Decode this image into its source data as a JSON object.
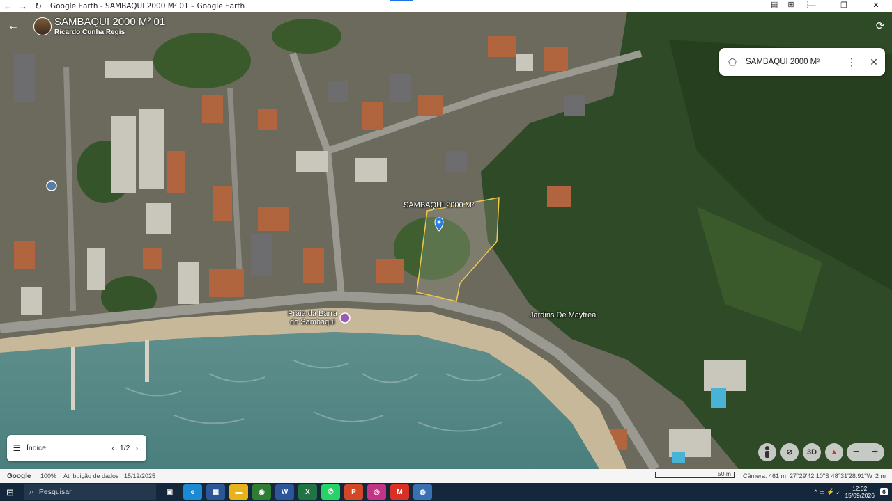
{
  "window": {
    "title": "Google Earth - SAMBAQUI 2000 M² 01 – Google Earth",
    "nav_back": "←",
    "nav_forward": "→",
    "nav_reload": "↻",
    "tool_icons": [
      "clipboard-icon",
      "translate-icon",
      "more-icon"
    ],
    "win_min": "—",
    "win_max": "❐",
    "win_close": "✕"
  },
  "header": {
    "title": "SAMBAQUI 2000 M² 01",
    "author": "Ricardo Cunha Regis",
    "back_icon": "←",
    "sync_icon": "⟳"
  },
  "info_card": {
    "name": "SAMBAQUI 2000 M²",
    "polygon_icon": "⬠",
    "more_icon": "⋮",
    "close_icon": "✕"
  },
  "map": {
    "polygon_label": "SAMBAQUI 2000 M²",
    "place_1_line1": "Praia da Barra",
    "place_1_line2": "do Sambaqui",
    "place_2": "Jardins De Maytrea",
    "polygon_color": "#f2c94c"
  },
  "index_card": {
    "list_icon": "☰",
    "label": "Índice",
    "prev": "‹",
    "page": "1/2",
    "next": "›"
  },
  "controls": {
    "pegman": "🚶",
    "tilt": "⊘",
    "three_d": "3D",
    "compass": "▲",
    "zoom_out": "−",
    "zoom_in": "+"
  },
  "status": {
    "google": "Google",
    "zoom": "100%",
    "attribution": "Atribuição de dados",
    "date": "15/12/2025",
    "scale": "50 m",
    "camera": "Câmera: 461 m",
    "coords": "27°29'42.10\"S 48°31'28.91\"W",
    "elevation": "2 m"
  },
  "taskbar": {
    "search": "Pesquisar",
    "apps": [
      {
        "name": "task-view",
        "glyph": "▣",
        "color": "#15273a"
      },
      {
        "name": "edge",
        "glyph": "e",
        "color": "#1b8ad3"
      },
      {
        "name": "store",
        "glyph": "▦",
        "color": "#2b5797"
      },
      {
        "name": "explorer",
        "glyph": "▬",
        "color": "#e8b21a"
      },
      {
        "name": "chrome",
        "glyph": "◉",
        "color": "#2e7d32"
      },
      {
        "name": "word",
        "glyph": "W",
        "color": "#2b579a"
      },
      {
        "name": "excel",
        "glyph": "X",
        "color": "#217346"
      },
      {
        "name": "whatsapp",
        "glyph": "✆",
        "color": "#25d366"
      },
      {
        "name": "powerpoint",
        "glyph": "P",
        "color": "#d24726"
      },
      {
        "name": "instagram",
        "glyph": "◎",
        "color": "#c13584"
      },
      {
        "name": "gmail",
        "glyph": "M",
        "color": "#d93025"
      },
      {
        "name": "google-earth",
        "glyph": "◍",
        "color": "#3a6fb0"
      }
    ],
    "tray": "^  ▭  ⚡  ♪",
    "time": "12:02",
    "date": "15/09/2026",
    "notif": "6"
  }
}
